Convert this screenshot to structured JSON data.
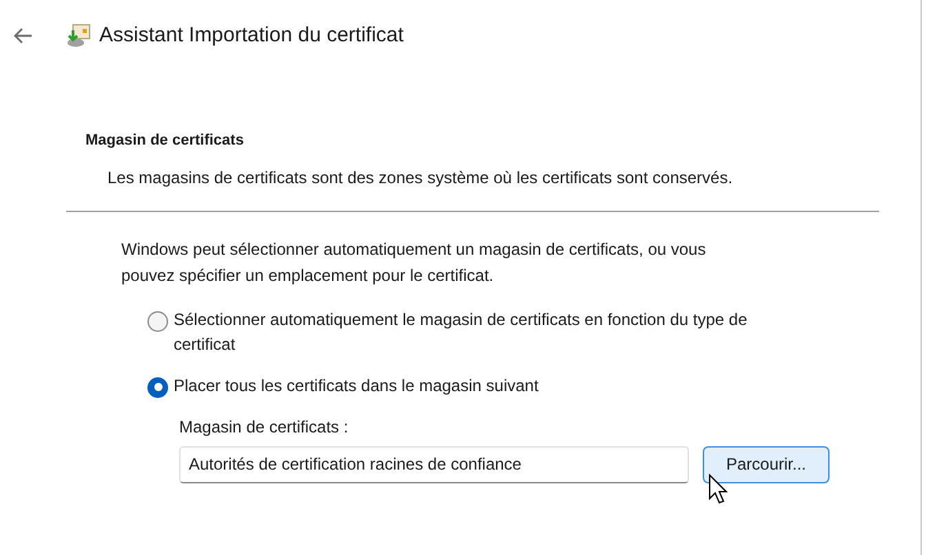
{
  "window": {
    "title": "Assistant Importation du certificat"
  },
  "header": {
    "title": "Magasin de certificats",
    "description": "Les magasins de certificats sont des zones système où les certificats sont conservés."
  },
  "intro": "Windows peut sélectionner automatiquement un magasin de certificats, ou vous pouvez spécifier un emplacement pour le certificat.",
  "options": [
    {
      "label": "Sélectionner automatiquement le magasin de certificats en fonction du type de certificat",
      "selected": false
    },
    {
      "label": "Placer tous les certificats dans le magasin suivant",
      "selected": true
    }
  ],
  "store": {
    "label": "Magasin de certificats :",
    "value": "Autorités de certification racines de confiance",
    "button": "Parcourir..."
  }
}
